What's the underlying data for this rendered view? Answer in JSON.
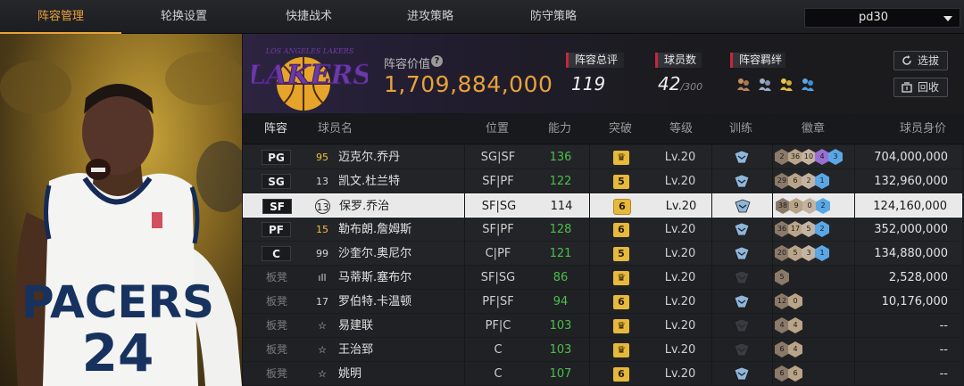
{
  "nav": {
    "tabs": [
      "阵容管理",
      "轮换设置",
      "快捷战术",
      "进攻策略",
      "防守策略"
    ],
    "active_tab": 0,
    "dropdown_value": "pd30"
  },
  "team": {
    "logo_text": "LOS ANGELES LAKERS",
    "value_label": "阵容价值",
    "value": "1,709,884,000",
    "rating_label": "阵容总评",
    "rating": "119",
    "players_label": "球员数",
    "players_count": "42",
    "players_max": "/300",
    "bond_label": "阵容羁绊",
    "select_button": "选拔",
    "recycle_button": "回收"
  },
  "table": {
    "headers": [
      "阵容",
      "球员名",
      "位置",
      "能力",
      "突破",
      "等级",
      "训练",
      "徽章",
      "球员身价"
    ],
    "rows": [
      {
        "pos": "PG",
        "num": "95",
        "name": "迈克尔.乔丹",
        "position": "SG|SF",
        "ability": "136",
        "break": "♛",
        "level": "Lv.20",
        "badges": [
          "2",
          "36",
          "10",
          "4",
          "3"
        ],
        "price": "704,000,000"
      },
      {
        "pos": "SG",
        "num": "13",
        "name": "凯文.杜兰特",
        "position": "SF|PF",
        "ability": "122",
        "break": "5",
        "level": "Lv.20",
        "badges": [
          "29",
          "6",
          "2",
          "1"
        ],
        "price": "132,960,000"
      },
      {
        "pos": "SF",
        "num": "13",
        "name": "保罗.乔治",
        "position": "SF|SG",
        "ability": "114",
        "break": "6",
        "level": "Lv.20",
        "badges": [
          "38",
          "9",
          "0",
          "2"
        ],
        "price": "124,160,000"
      },
      {
        "pos": "PF",
        "num": "15",
        "name": "勒布朗.詹姆斯",
        "position": "SF|PF",
        "ability": "128",
        "break": "6",
        "level": "Lv.20",
        "badges": [
          "36",
          "17",
          "5",
          "2"
        ],
        "price": "352,000,000"
      },
      {
        "pos": "C",
        "num": "99",
        "name": "沙奎尔.奥尼尔",
        "position": "C|PF",
        "ability": "121",
        "break": "5",
        "level": "Lv.20",
        "badges": [
          "20",
          "5",
          "3",
          "1"
        ],
        "price": "134,880,000"
      },
      {
        "pos": "板凳",
        "num": "ıll",
        "name": "马蒂斯.塞布尔",
        "position": "SF|SG",
        "ability": "86",
        "break": "♛",
        "level": "Lv.20",
        "badges": [
          "5"
        ],
        "price": "2,528,000"
      },
      {
        "pos": "板凳",
        "num": "17",
        "name": "罗伯特.卡温顿",
        "position": "PF|SF",
        "ability": "94",
        "break": "6",
        "level": "Lv.20",
        "badges": [
          "12",
          "0"
        ],
        "price": "10,176,000"
      },
      {
        "pos": "板凳",
        "num": "☆",
        "name": "易建联",
        "position": "PF|C",
        "ability": "103",
        "break": "♛",
        "level": "Lv.20",
        "badges": [
          "4",
          "4"
        ],
        "price": "--"
      },
      {
        "pos": "板凳",
        "num": "☆",
        "name": "王治郅",
        "position": "C",
        "ability": "103",
        "break": "♛",
        "level": "Lv.20",
        "badges": [
          "6",
          "4"
        ],
        "price": "--"
      },
      {
        "pos": "板凳",
        "num": "☆",
        "name": "姚明",
        "position": "C",
        "ability": "107",
        "break": "6",
        "level": "Lv.20",
        "badges": [
          "6",
          "6"
        ],
        "price": "--"
      }
    ]
  },
  "player_image": {
    "jersey_name": "PACERS",
    "jersey_number": "24"
  },
  "colors": {
    "accent": "#e8a23a",
    "green": "#4cbf4a",
    "red_marker": "#c8263a"
  }
}
